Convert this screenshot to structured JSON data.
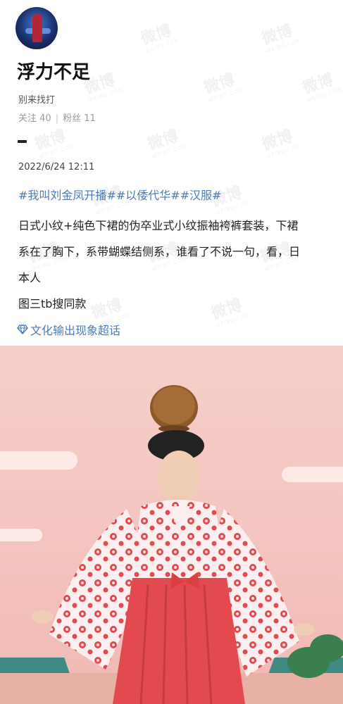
{
  "profile": {
    "name": "浮力不足",
    "bio": "别来找打",
    "following_label": "关注",
    "following_count": "40",
    "stats_separator": "|",
    "followers_label": "粉丝",
    "followers_count": "11"
  },
  "post": {
    "date": "2022/6/24 12:11",
    "tags": "#我叫刘金凤开播##以倭代华##汉服#",
    "body_lines": [
      "日式小纹+纯色下裙的伪卒业式小纹振袖袴裤套装，下裙",
      "系在了胸下，系带蝴蝶结侧系，谁看了不说一句，看，日",
      "本人"
    ],
    "note": "图三tb搜同款",
    "supertopic": "文化输出现象超话",
    "supertopic_icon": "diamond-icon"
  },
  "watermark": {
    "text": "微博",
    "subtext": "WEIBO.COM"
  },
  "colors": {
    "link_blue": "#4b7cb8",
    "meta_gray": "#9a9a9a",
    "photo_background": "#f4c4c0",
    "robe_red": "#e24a4f"
  }
}
